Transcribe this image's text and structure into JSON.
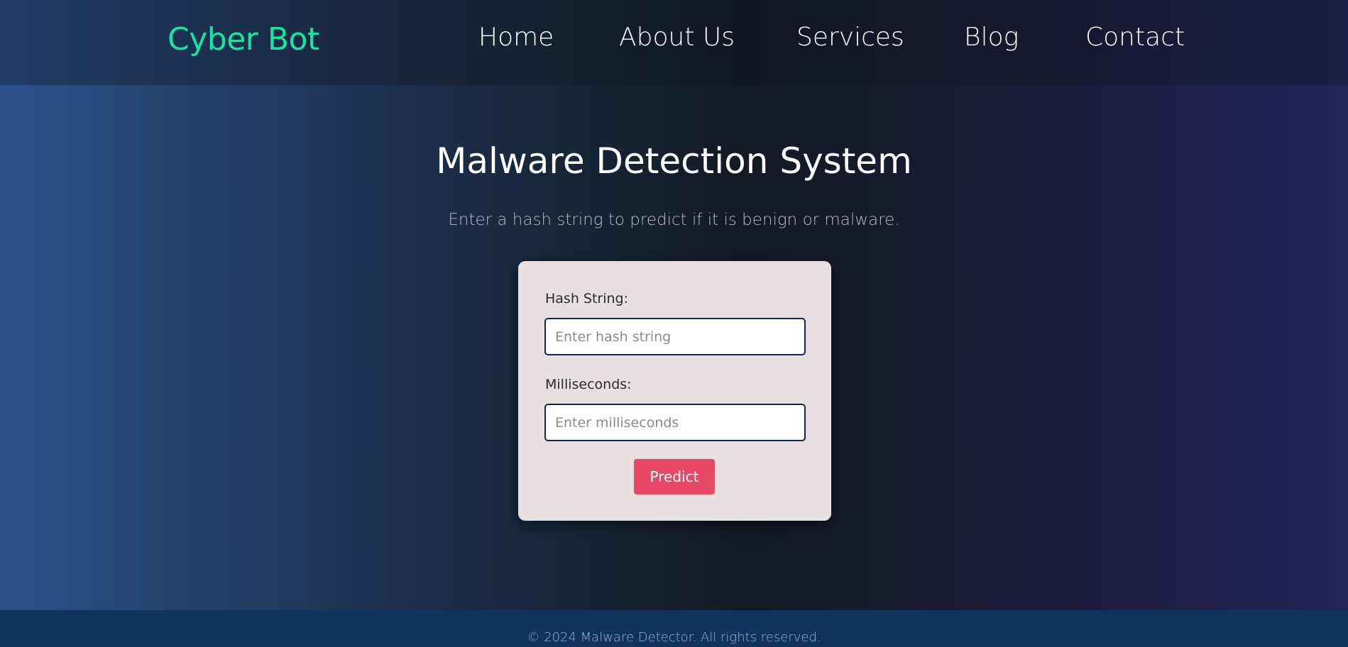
{
  "brand": "Cyber Bot",
  "nav": {
    "home": "Home",
    "about": "About Us",
    "services": "Services",
    "blog": "Blog",
    "contact": "Contact"
  },
  "main": {
    "title": "Malware Detection System",
    "subtitle": "Enter a hash string to predict if it is benign or malware."
  },
  "form": {
    "hash_label": "Hash String:",
    "hash_placeholder": "Enter hash string",
    "hash_value": "",
    "ms_label": "Milliseconds:",
    "ms_placeholder": "Enter milliseconds",
    "ms_value": "",
    "submit_label": "Predict"
  },
  "footer": {
    "text": "© 2024 Malware Detector. All rights reserved."
  },
  "colors": {
    "brand": "#19e3a0",
    "button": "#e74864",
    "card": "#e8e0e0",
    "footer": "#12325f",
    "input_border": "#102552"
  }
}
